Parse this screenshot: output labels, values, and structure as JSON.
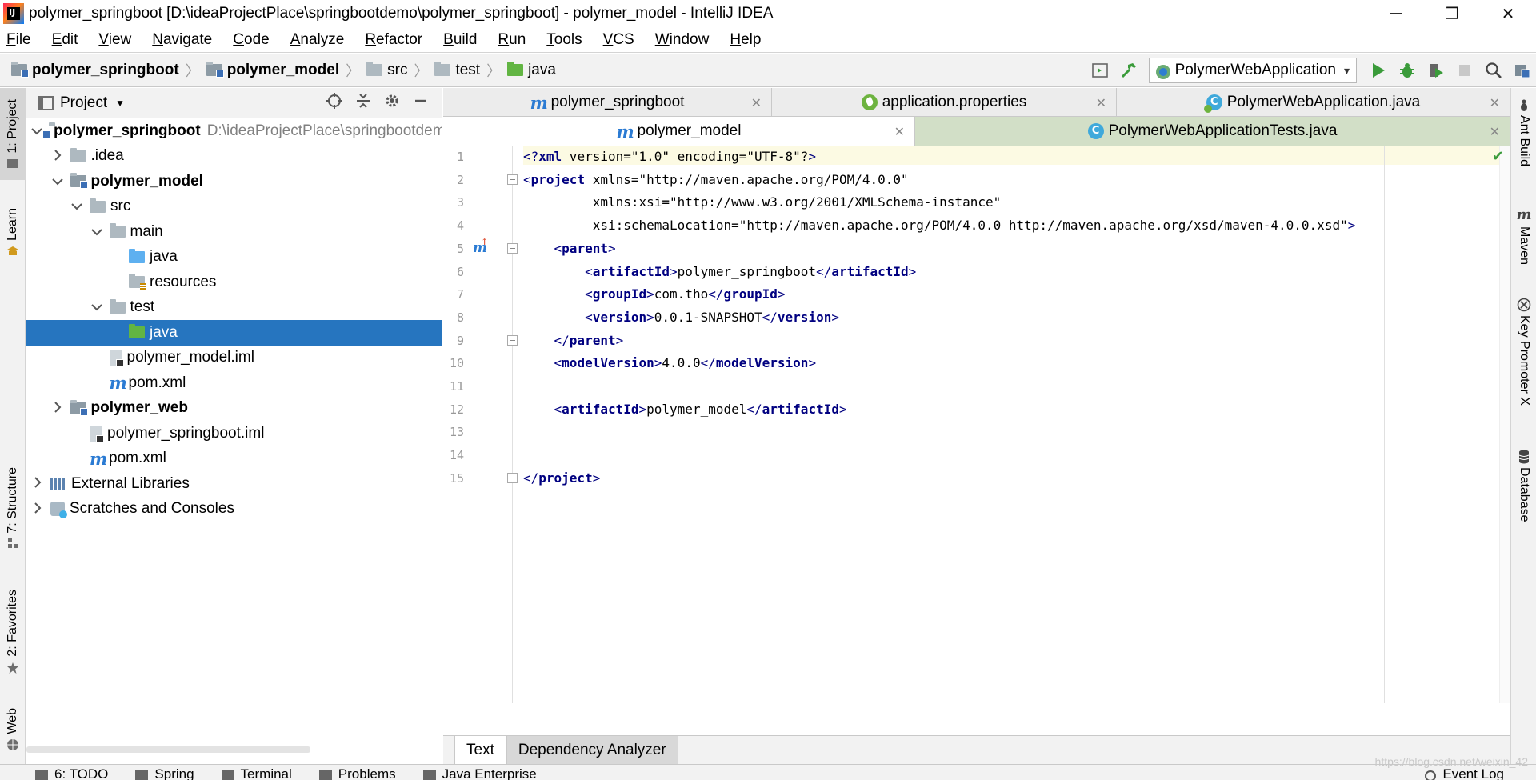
{
  "window": {
    "title": "polymer_springboot [D:\\ideaProjectPlace\\springbootdemo\\polymer_springboot] - polymer_model - IntelliJ IDEA",
    "controls": {
      "minimize": "─",
      "maximize": "❐",
      "close": "✕"
    }
  },
  "menu": [
    {
      "label": "File"
    },
    {
      "label": "Edit"
    },
    {
      "label": "View"
    },
    {
      "label": "Navigate"
    },
    {
      "label": "Code"
    },
    {
      "label": "Analyze"
    },
    {
      "label": "Refactor"
    },
    {
      "label": "Build"
    },
    {
      "label": "Run"
    },
    {
      "label": "Tools"
    },
    {
      "label": "VCS"
    },
    {
      "label": "Window"
    },
    {
      "label": "Help"
    }
  ],
  "breadcrumb": [
    {
      "label": "polymer_springboot",
      "bold": true,
      "icon": "module-folder-icon"
    },
    {
      "label": "polymer_model",
      "bold": true,
      "icon": "module-folder-icon"
    },
    {
      "label": "src",
      "bold": false,
      "icon": "folder-icon"
    },
    {
      "label": "test",
      "bold": false,
      "icon": "folder-icon"
    },
    {
      "label": "java",
      "bold": false,
      "icon": "test-source-folder-icon"
    }
  ],
  "toolbar": {
    "run_config": "PolymerWebApplication"
  },
  "left_tools": {
    "project": "1: Project",
    "learn": "Learn",
    "structure": "7: Structure",
    "favorites": "2: Favorites",
    "web": "Web"
  },
  "project_panel": {
    "title": "Project",
    "tree": [
      {
        "name": "polymer_springboot",
        "path": "D:\\ideaProjectPlace\\springbootdemo",
        "bold": true,
        "depth": 0,
        "arrow": "down",
        "icon": "module"
      },
      {
        "name": ".idea",
        "path": "",
        "bold": false,
        "depth": 1,
        "arrow": "right",
        "icon": "folder"
      },
      {
        "name": "polymer_model",
        "path": "",
        "bold": true,
        "depth": 1,
        "arrow": "down",
        "icon": "module"
      },
      {
        "name": "src",
        "path": "",
        "bold": false,
        "depth": 2,
        "arrow": "down",
        "icon": "folder"
      },
      {
        "name": "main",
        "path": "",
        "bold": false,
        "depth": 3,
        "arrow": "down",
        "icon": "folder"
      },
      {
        "name": "java",
        "path": "",
        "bold": false,
        "depth": 4,
        "arrow": "none",
        "icon": "source"
      },
      {
        "name": "resources",
        "path": "",
        "bold": false,
        "depth": 4,
        "arrow": "none",
        "icon": "resources"
      },
      {
        "name": "test",
        "path": "",
        "bold": false,
        "depth": 3,
        "arrow": "down",
        "icon": "folder"
      },
      {
        "name": "java",
        "path": "",
        "bold": false,
        "depth": 4,
        "arrow": "none",
        "icon": "test-source",
        "selected": true
      },
      {
        "name": "polymer_model.iml",
        "path": "",
        "bold": false,
        "depth": 3,
        "arrow": "none",
        "icon": "iml"
      },
      {
        "name": "pom.xml",
        "path": "",
        "bold": false,
        "depth": 3,
        "arrow": "none",
        "icon": "maven"
      },
      {
        "name": "polymer_web",
        "path": "",
        "bold": true,
        "depth": 1,
        "arrow": "right",
        "icon": "module"
      },
      {
        "name": "polymer_springboot.iml",
        "path": "",
        "bold": false,
        "depth": 2,
        "arrow": "none",
        "icon": "iml"
      },
      {
        "name": "pom.xml",
        "path": "",
        "bold": false,
        "depth": 2,
        "arrow": "none",
        "icon": "maven"
      },
      {
        "name": "External Libraries",
        "path": "",
        "bold": false,
        "depth": 0,
        "arrow": "right",
        "icon": "library"
      },
      {
        "name": "Scratches and Consoles",
        "path": "",
        "bold": false,
        "depth": 0,
        "arrow": "right",
        "icon": "scratch"
      }
    ]
  },
  "editor_tabs_row1": [
    {
      "label": "polymer_springboot",
      "icon": "maven",
      "close": "✕"
    },
    {
      "label": "application.properties",
      "icon": "spring",
      "close": "✕"
    },
    {
      "label": "PolymerWebApplication.java",
      "icon": "class-spring",
      "close": "✕"
    }
  ],
  "editor_tabs_row2": [
    {
      "label": "polymer_model",
      "icon": "maven",
      "close": "✕",
      "active": true
    },
    {
      "label": "PolymerWebApplicationTests.java",
      "icon": "class",
      "close": "✕",
      "active": false
    }
  ],
  "code": {
    "line_numbers": [
      "1",
      "2",
      "3",
      "4",
      "5",
      "6",
      "7",
      "8",
      "9",
      "10",
      "11",
      "12",
      "13",
      "14",
      "15"
    ],
    "lines": [
      "<?xml version=\"1.0\" encoding=\"UTF-8\"?>",
      "<project xmlns=\"http://maven.apache.org/POM/4.0.0\"",
      "         xmlns:xsi=\"http://www.w3.org/2001/XMLSchema-instance\"",
      "         xsi:schemaLocation=\"http://maven.apache.org/POM/4.0.0 http://maven.apache.org/xsd/maven-4.0.0.xsd\">",
      "    <parent>",
      "        <artifactId>polymer_springboot</artifactId>",
      "        <groupId>com.tho</groupId>",
      "        <version>0.0.1-SNAPSHOT</version>",
      "    </parent>",
      "    <modelVersion>4.0.0</modelVersion>",
      "",
      "    <artifactId>polymer_model</artifactId>",
      "",
      "",
      "</project>"
    ]
  },
  "bottom_editor_tabs": [
    {
      "label": "Text",
      "active": true
    },
    {
      "label": "Dependency Analyzer",
      "active": false
    }
  ],
  "right_tools": {
    "ant": "Ant Build",
    "maven": "Maven",
    "key_promoter": "Key Promoter X",
    "database": "Database"
  },
  "status_bar": {
    "items": [
      "6: TODO",
      "Spring",
      "Terminal",
      "Problems",
      "Java Enterprise"
    ],
    "event_log": "Event Log",
    "watermark": "https://blog.csdn.net/weixin_42"
  },
  "colors": {
    "selection": "#2675bf",
    "tag": "#000080",
    "attribute": "#0000ff",
    "value": "#008000",
    "run_green": "#3a9b3a"
  }
}
